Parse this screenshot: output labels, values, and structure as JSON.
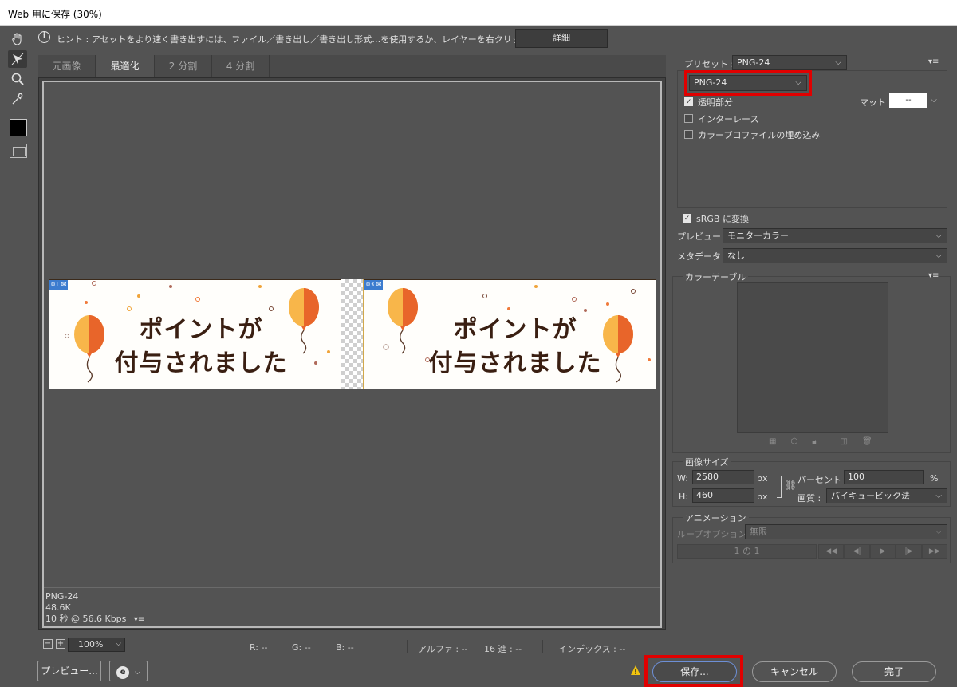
{
  "window": {
    "title": "Web 用に保存 (30%)"
  },
  "hint": {
    "text": "ヒント : アセットをより速く書き出すには、ファイル／書き出し／書き出し形式…を使用するか、レイヤーを右クリックして使用。",
    "detail_button": "詳細"
  },
  "tabs": [
    {
      "label": "元画像",
      "active": false
    },
    {
      "label": "最適化",
      "active": true
    },
    {
      "label": "2 分割",
      "active": false
    },
    {
      "label": "4 分割",
      "active": false
    }
  ],
  "preview": {
    "slices": [
      "01",
      "03"
    ],
    "banner_line1": "ポイントが",
    "banner_line2": "付与されました",
    "format": "PNG-24",
    "size": "48.6K",
    "time": "10 秒 @ 56.6 Kbps"
  },
  "statusbar": {
    "zoom": "100%",
    "r": "R: --",
    "g": "G: --",
    "b": "B: --",
    "alpha": "アルファ : --",
    "hex": "16 進 : --",
    "index": "インデックス : --"
  },
  "buttons": {
    "preview": "プレビュー...",
    "save": "保存...",
    "cancel": "キャンセル",
    "done": "完了"
  },
  "settings": {
    "preset_label": "プリセット :",
    "preset_value": "PNG-24",
    "format_value": "PNG-24",
    "transparency_label": "透明部分",
    "transparency_checked": true,
    "interlace_label": "インターレース",
    "interlace_checked": false,
    "embed_profile_label": "カラープロファイルの埋め込み",
    "embed_profile_checked": false,
    "matte_label": "マット :",
    "matte_value": "--",
    "srgb_label": "sRGB に変換",
    "srgb_checked": true,
    "preview_label": "プレビュー :",
    "preview_value": "モニターカラー",
    "metadata_label": "メタデータ :",
    "metadata_value": "なし"
  },
  "color_table": {
    "title": "カラーテーブル"
  },
  "image_size": {
    "title": "画像サイズ",
    "w_label": "W:",
    "w_value": "2580",
    "h_label": "H:",
    "h_value": "460",
    "unit": "px",
    "percent_label": "パーセント :",
    "percent_value": "100",
    "percent_unit": "%",
    "quality_label": "画質 :",
    "quality_value": "バイキュービック法"
  },
  "animation": {
    "title": "アニメーション",
    "loop_label": "ループオプション :",
    "loop_value": "無限",
    "frame_counter": "1 の 1"
  },
  "colors": {
    "highlight": "#e00000",
    "save_button_border": "#6d8fd6",
    "banner_text": "#3a1f12",
    "balloon_orange": "#f0822a"
  }
}
